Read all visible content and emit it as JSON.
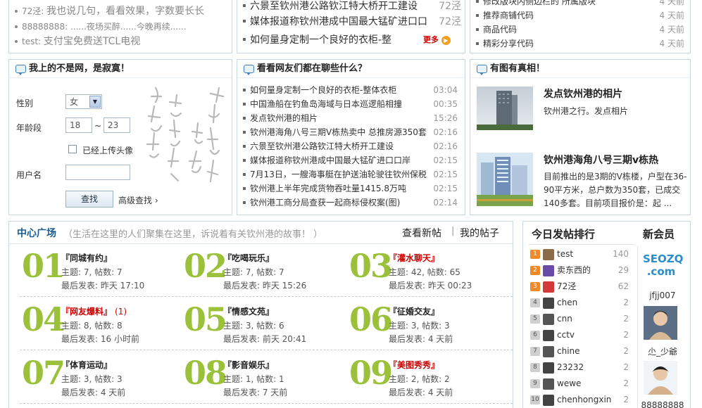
{
  "top_left": {
    "items": [
      {
        "user": "72泾",
        "text": "我也说几句，看看效果，字数要长长"
      },
      {
        "user": "88888888",
        "text": "......夜场买醉......今晚再续......"
      },
      {
        "user": "test",
        "text": "支付宝免费送TCL电视"
      }
    ]
  },
  "top_middle": {
    "items": [
      {
        "title": "六景至钦州港公路钦江特大桥开工建设",
        "author": "72泾"
      },
      {
        "title": "媒体报道称钦州港成中国最大锰矿进口口",
        "author": "72泾"
      },
      {
        "title": "如何量身定制一个良好的衣柜-整",
        "author": ""
      }
    ],
    "more_label": "更多"
  },
  "top_right": {
    "items": [
      {
        "title": "修改版块内侧边栏的 所属版块",
        "time": "4 天前"
      },
      {
        "title": "推荐商铺代码",
        "time": "4 天前"
      },
      {
        "title": "商品代码",
        "time": "4 天前"
      },
      {
        "title": "精彩分享代码",
        "time": "4 天前"
      }
    ]
  },
  "dating": {
    "title": "我上的不是网，是寂寞！",
    "gender_label": "性别",
    "gender_value": "女",
    "age_label": "年龄段",
    "age_from": "18",
    "age_sep": "~",
    "age_to": "23",
    "avatar_checkbox_label": "已经上传头像",
    "username_label": "用户名",
    "username_value": "",
    "search_button": "查找",
    "advanced_link": "高级查找 ›"
  },
  "chat": {
    "title": "看看网友们都在聊些什么？",
    "items": [
      {
        "title": "如何量身定制一个良好的衣柜-整体衣柜",
        "time": "03:04"
      },
      {
        "title": "中国渔船在钓鱼岛海域与日本巡逻船相撞",
        "time": "00:35"
      },
      {
        "title": "发点钦州港的相片",
        "time": "15:26"
      },
      {
        "title": "钦州港海角八号三期V栋热卖中 总推房源350套",
        "time": "02:16"
      },
      {
        "title": "六景至钦州港公路钦江特大桥开工建设",
        "time": "02:16"
      },
      {
        "title": "媒体报道称钦州港成中国最大锰矿进口口岸",
        "time": "02:15"
      },
      {
        "title": "7月13日，一艘海事艇在护送油轮驶往钦州保税",
        "time": "02:15"
      },
      {
        "title": "钦州港上半年完成货物吞吐量1415.8万吨",
        "time": "02:15"
      },
      {
        "title": "钦州港工商分局查获一起商标侵权案(图)",
        "time": "02:14"
      }
    ]
  },
  "pics": {
    "title": "有图有真相！",
    "items": [
      {
        "title": "发点钦州港的相片",
        "desc": "钦州港之行。发点相片"
      },
      {
        "title": "钦州港海角八号三期v栋热",
        "desc": "目前推出的是3期的V栋楼，户型在36-90平方米，总户数为350套，已成交140多套。目前项目报价是：起 ..."
      }
    ]
  },
  "plaza": {
    "title": "中心广场",
    "subtitle": "（生活在这里的人们聚集在这里，诉说着有关钦州港的故事！ ）",
    "link_new": "查看新帖",
    "link_sep": "|",
    "link_mine": "我的帖子",
    "forums": [
      {
        "num": "01",
        "name": "『同城有约』",
        "red": false,
        "extra": "",
        "stats": "主题: 7, 帖数: 7",
        "last": "最后发表: 昨天 17:10"
      },
      {
        "num": "02",
        "name": "『吃喝玩乐』",
        "red": false,
        "extra": "",
        "stats": "主题: 7, 帖数: 7",
        "last": "最后发表: 昨天 15:26"
      },
      {
        "num": "03",
        "name": "『灌水聊天』",
        "red": true,
        "extra": "",
        "stats": "主题: 42, 帖数: 65",
        "last": "最后发表: 昨天 00:23"
      },
      {
        "num": "04",
        "name": "『网友爆料』",
        "red": true,
        "extra": "(1)",
        "stats": "主题: 8, 帖数: 8",
        "last": "最后发表: 16 小时前"
      },
      {
        "num": "05",
        "name": "『情感文苑』",
        "red": false,
        "extra": "",
        "stats": "主题: 3, 帖数: 6",
        "last": "最后发表: 前天 20:41"
      },
      {
        "num": "06",
        "name": "『征婚交友』",
        "red": false,
        "extra": "",
        "stats": "主题: 3, 帖数: 3",
        "last": "最后发表: 4 天前"
      },
      {
        "num": "07",
        "name": "『体育运动』",
        "red": false,
        "extra": "",
        "stats": "主题: 3, 帖数: 3",
        "last": "最后发表: 4 天前"
      },
      {
        "num": "08",
        "name": "『影音娱乐』",
        "red": false,
        "extra": "",
        "stats": "主题: 1, 帖数: 1",
        "last": "最后发表: 7 天前"
      },
      {
        "num": "09",
        "name": "『美图秀秀』",
        "red": true,
        "extra": "",
        "stats": "主题: 2, 帖数: 2",
        "last": "最后发表: 4 天前"
      }
    ]
  },
  "ranking": {
    "title": "今日发帖排行",
    "items": [
      {
        "rank": "1",
        "name": "test",
        "count": "140"
      },
      {
        "rank": "2",
        "name": "卖东西的",
        "count": "29"
      },
      {
        "rank": "3",
        "name": "72泾",
        "count": "62"
      },
      {
        "rank": "4",
        "name": "chen",
        "count": "2"
      },
      {
        "rank": "5",
        "name": "cnn",
        "count": "2"
      },
      {
        "rank": "6",
        "name": "cctv",
        "count": "2"
      },
      {
        "rank": "7",
        "name": "chine",
        "count": "2"
      },
      {
        "rank": "8",
        "name": "23232",
        "count": "2"
      },
      {
        "rank": "9",
        "name": "wewe",
        "count": "2"
      },
      {
        "rank": "10",
        "name": "chenhongxin",
        "count": "2"
      }
    ]
  },
  "new_members": {
    "title": "新会员",
    "logo_text": "SEOZQ .com",
    "members": [
      {
        "name": "jfjj007"
      },
      {
        "name": "尐_少爺"
      },
      {
        "name": "88888888"
      }
    ]
  }
}
